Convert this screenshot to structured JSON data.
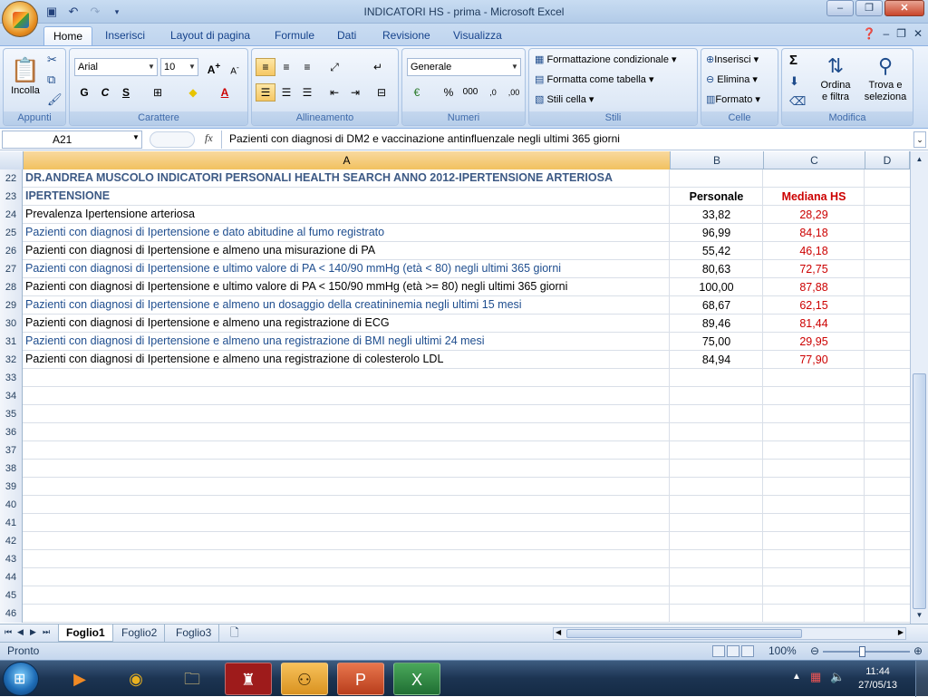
{
  "window": {
    "title": "INDICATORI HS - prima - Microsoft Excel",
    "controls": [
      "–",
      "❐",
      "✕"
    ]
  },
  "ribbon_tabs": [
    "Home",
    "Inserisci",
    "Layout di pagina",
    "Formule",
    "Dati",
    "Revisione",
    "Visualizza"
  ],
  "ribbon": {
    "clipboard": {
      "paste": "Incolla",
      "caption": "Appunti"
    },
    "font": {
      "name": "Arial",
      "size": "10",
      "bold": "G",
      "italic": "C",
      "underline": "S",
      "caption": "Carattere"
    },
    "alignment": {
      "caption": "Allineamento"
    },
    "number": {
      "format": "Generale",
      "percent": "%",
      "thousands": "000",
      "caption": "Numeri"
    },
    "styles": {
      "conditional": "Formattazione condizionale",
      "as_table": "Formatta come tabella",
      "cell_styles": "Stili cella",
      "caption": "Stili"
    },
    "cells": {
      "insert": "Inserisci",
      "delete": "Elimina",
      "format": "Formato",
      "caption": "Celle"
    },
    "editing": {
      "sum": "Σ",
      "sort_line1": "Ordina",
      "sort_line2": "e filtra",
      "find_line1": "Trova e",
      "find_line2": "seleziona",
      "caption": "Modifica"
    }
  },
  "formula_bar": {
    "name_box": "A21",
    "fx": "fx",
    "content": "Pazienti con diagnosi di DM2 e vaccinazione antinfluenzale negli ultimi 365 giorni"
  },
  "columns": [
    "A",
    "B",
    "C",
    "D"
  ],
  "rows": [
    {
      "n": "22",
      "a": "DR.ANDREA MUSCOLO INDICATORI PERSONALI HEALTH SEARCH ANNO 2012-IPERTENSIONE ARTERIOSA",
      "b": "",
      "c": "",
      "style": "title"
    },
    {
      "n": "23",
      "a": "IPERTENSIONE",
      "b": "Personale",
      "c": "Mediana HS",
      "style": "header"
    },
    {
      "n": "24",
      "a": "Prevalenza Ipertensione arteriosa",
      "b": "33,82",
      "c": "28,29",
      "style": "black"
    },
    {
      "n": "25",
      "a": "Pazienti con diagnosi di Ipertensione e dato abitudine al fumo registrato",
      "b": "96,99",
      "c": "84,18",
      "style": "blue"
    },
    {
      "n": "26",
      "a": "Pazienti con diagnosi di Ipertensione e almeno una misurazione di PA",
      "b": "55,42",
      "c": "46,18",
      "style": "black"
    },
    {
      "n": "27",
      "a": "Pazienti con diagnosi di Ipertensione e ultimo valore di PA < 140/90 mmHg (età < 80) negli ultimi 365 giorni",
      "b": "80,63",
      "c": "72,75",
      "style": "blue"
    },
    {
      "n": "28",
      "a": "Pazienti con diagnosi di Ipertensione e ultimo valore di PA < 150/90 mmHg (età >= 80) negli ultimi 365 giorni",
      "b": "100,00",
      "c": "87,88",
      "style": "black"
    },
    {
      "n": "29",
      "a": "Pazienti con diagnosi di Ipertensione e almeno un dosaggio della creatininemia negli ultimi 15 mesi",
      "b": "68,67",
      "c": "62,15",
      "style": "blue"
    },
    {
      "n": "30",
      "a": "Pazienti con diagnosi di Ipertensione e almeno una registrazione di ECG",
      "b": "89,46",
      "c": "81,44",
      "style": "black"
    },
    {
      "n": "31",
      "a": "Pazienti con diagnosi di Ipertensione e almeno una registrazione di BMI negli ultimi 24 mesi",
      "b": "75,00",
      "c": "29,95",
      "style": "blue"
    },
    {
      "n": "32",
      "a": "Pazienti con diagnosi di Ipertensione e almeno una registrazione di colesterolo LDL",
      "b": "84,94",
      "c": "77,90",
      "style": "black"
    },
    {
      "n": "33",
      "a": "",
      "b": "",
      "c": "",
      "style": "black"
    },
    {
      "n": "34",
      "a": "",
      "b": "",
      "c": "",
      "style": "black"
    },
    {
      "n": "35",
      "a": "",
      "b": "",
      "c": "",
      "style": "black"
    },
    {
      "n": "36",
      "a": "",
      "b": "",
      "c": "",
      "style": "black"
    },
    {
      "n": "37",
      "a": "",
      "b": "",
      "c": "",
      "style": "black"
    },
    {
      "n": "38",
      "a": "",
      "b": "",
      "c": "",
      "style": "black"
    },
    {
      "n": "39",
      "a": "",
      "b": "",
      "c": "",
      "style": "black"
    },
    {
      "n": "40",
      "a": "",
      "b": "",
      "c": "",
      "style": "black"
    },
    {
      "n": "41",
      "a": "",
      "b": "",
      "c": "",
      "style": "black"
    },
    {
      "n": "42",
      "a": "",
      "b": "",
      "c": "",
      "style": "black"
    },
    {
      "n": "43",
      "a": "",
      "b": "",
      "c": "",
      "style": "black"
    },
    {
      "n": "44",
      "a": "",
      "b": "",
      "c": "",
      "style": "black"
    },
    {
      "n": "45",
      "a": "",
      "b": "",
      "c": "",
      "style": "black"
    },
    {
      "n": "46",
      "a": "",
      "b": "",
      "c": "",
      "style": "black"
    }
  ],
  "sheet_tabs": [
    "Foglio1",
    "Foglio2",
    "Foglio3"
  ],
  "active_sheet": "Foglio1",
  "status": {
    "text": "Pronto",
    "zoom": "100%"
  },
  "taskbar": {
    "apps": [
      "media-player",
      "chrome",
      "explorer",
      "castle-app",
      "family-app",
      "powerpoint",
      "excel"
    ],
    "time": "11:44",
    "date": "27/05/13"
  },
  "colors": {
    "title_blue": "#3d5a85",
    "row_blue": "#1f4e8f",
    "median_red": "#cc0000",
    "selected_header": "#f1c15f"
  }
}
